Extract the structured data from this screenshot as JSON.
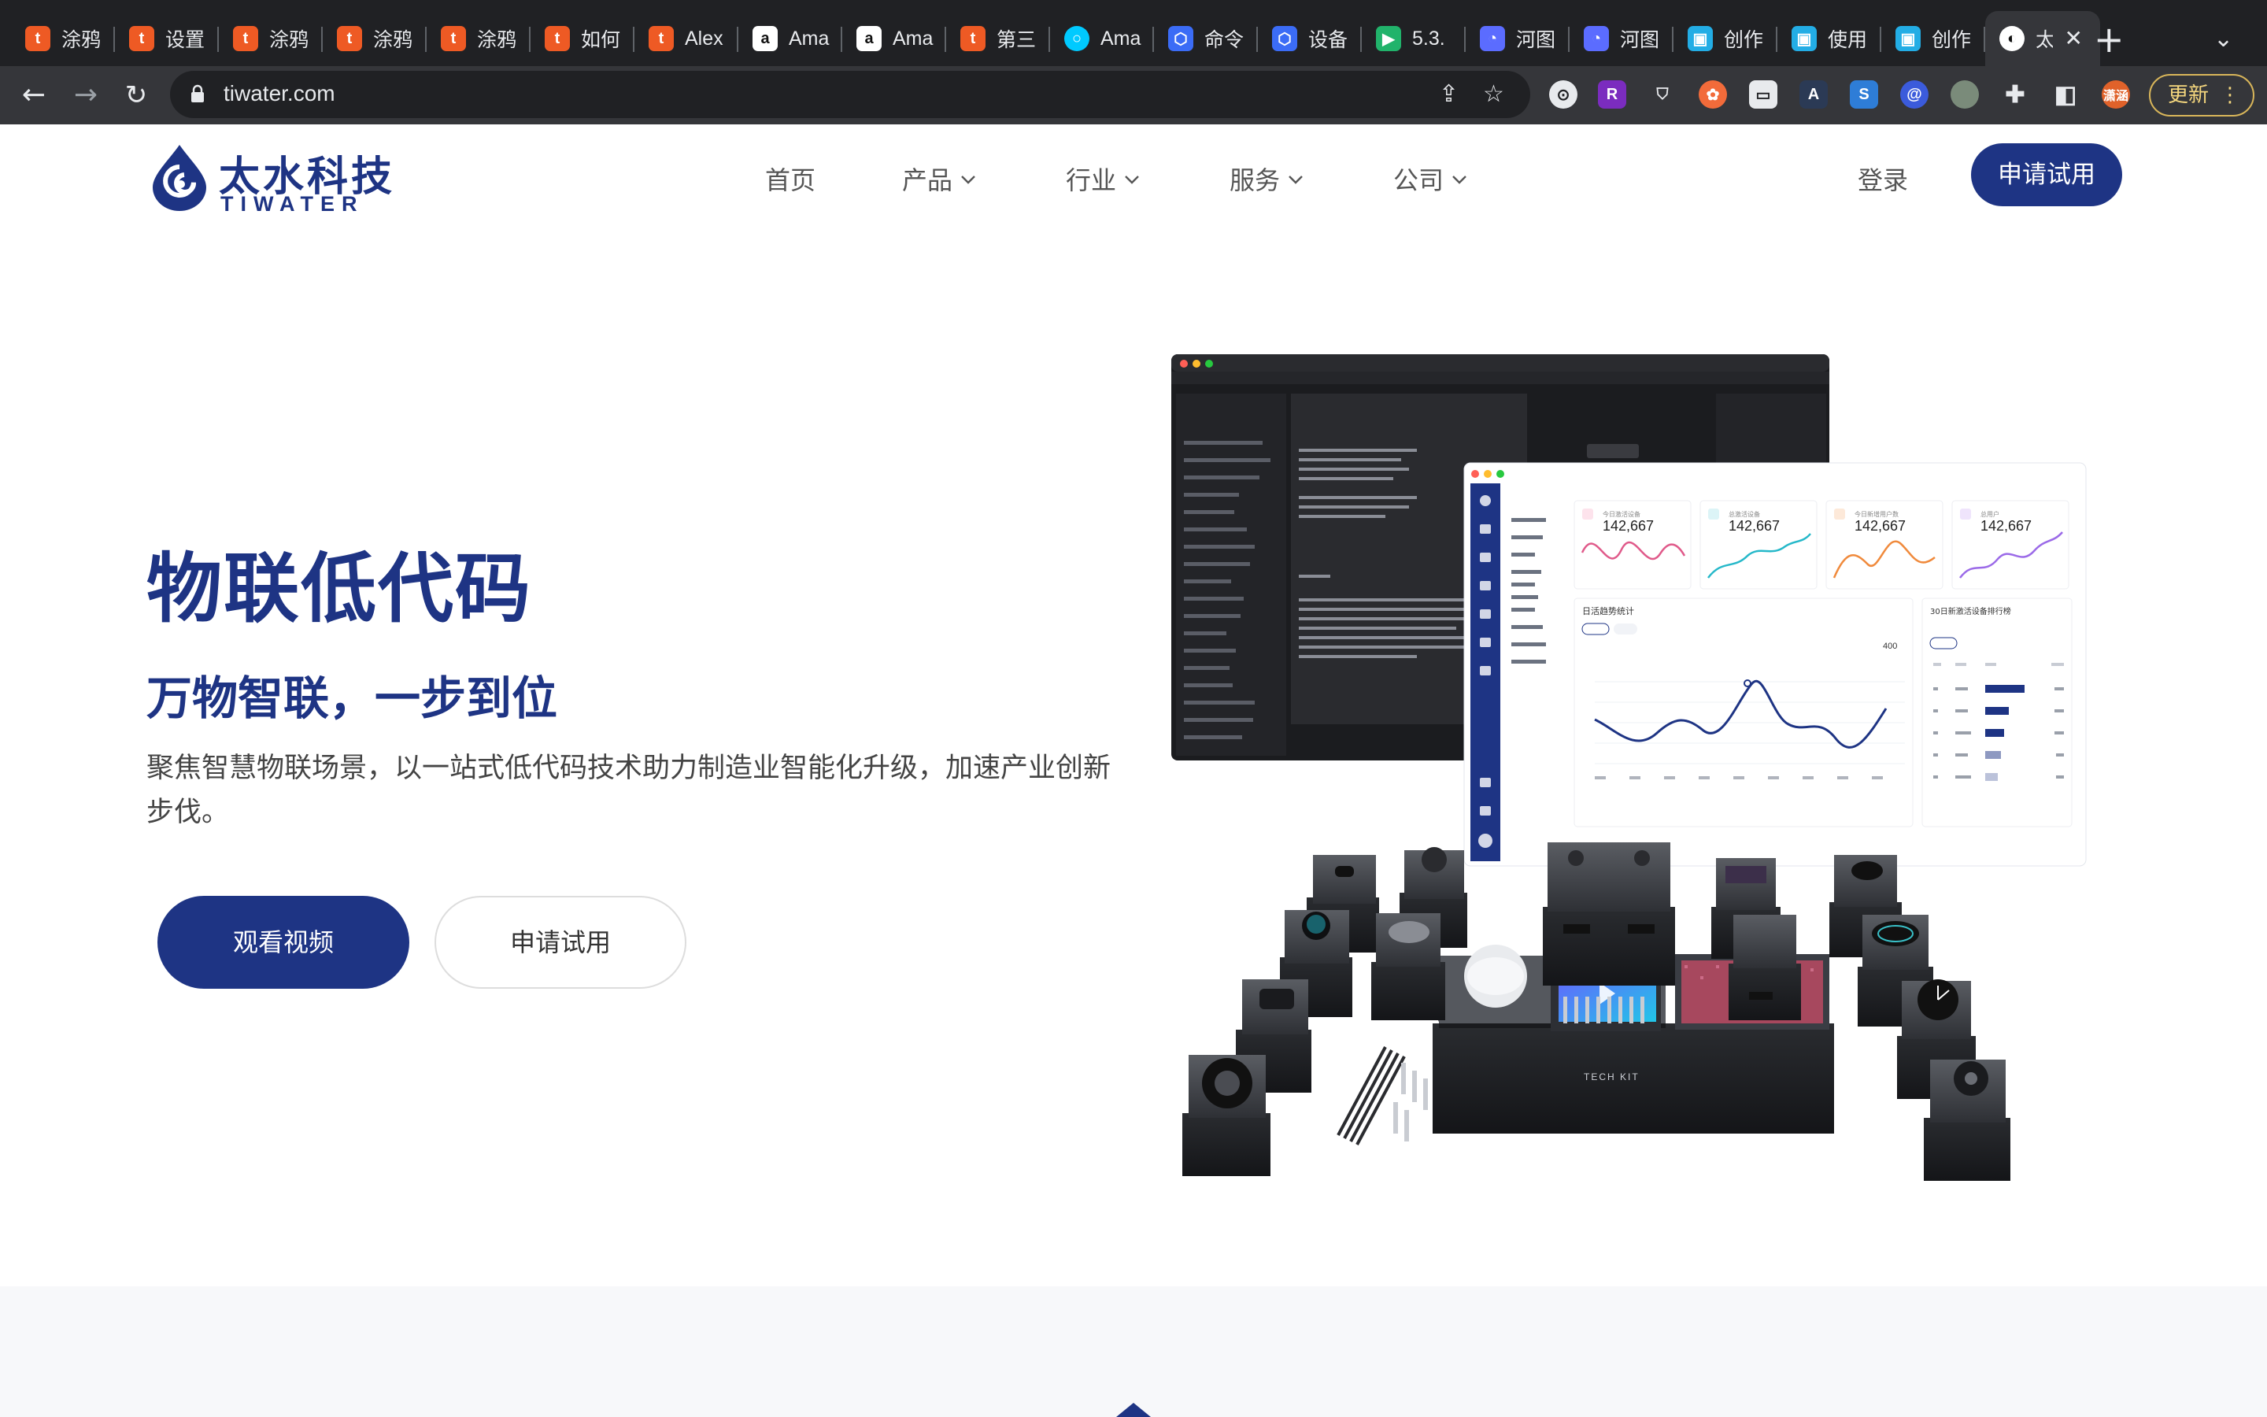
{
  "browser": {
    "tabs": [
      {
        "label": "涂鸦",
        "icon": "tuya-icon",
        "color": "#ee5a24"
      },
      {
        "label": "设置",
        "icon": "tuya-icon",
        "color": "#ee5a24"
      },
      {
        "label": "涂鸦",
        "icon": "tuya-icon",
        "color": "#ee5a24"
      },
      {
        "label": "涂鸦",
        "icon": "tuya-icon",
        "color": "#ee5a24"
      },
      {
        "label": "涂鸦",
        "icon": "tuya-icon",
        "color": "#ee5a24"
      },
      {
        "label": "如何",
        "icon": "tuya-icon",
        "color": "#ee5a24"
      },
      {
        "label": "Alex",
        "icon": "tuya-icon",
        "color": "#ee5a24"
      },
      {
        "label": "Ama",
        "icon": "amazon-icon",
        "color": "#ffffff"
      },
      {
        "label": "Ama",
        "icon": "amazon-icon",
        "color": "#ffffff"
      },
      {
        "label": "第三",
        "icon": "tuya-icon",
        "color": "#ee5a24"
      },
      {
        "label": "Ama",
        "icon": "alexa-icon",
        "color": "#00caff"
      },
      {
        "label": "命令",
        "icon": "hexagon-icon",
        "color": "#3b6cf6"
      },
      {
        "label": "设备",
        "icon": "hexagon-icon",
        "color": "#3b6cf6"
      },
      {
        "label": "5.3.",
        "icon": "play-icon",
        "color": "#21b36b"
      },
      {
        "label": "河图",
        "icon": "ghost-icon",
        "color": "#5b6cff"
      },
      {
        "label": "河图",
        "icon": "ghost-icon",
        "color": "#5b6cff"
      },
      {
        "label": "创作",
        "icon": "bilibili-icon",
        "color": "#23ade5"
      },
      {
        "label": "使用",
        "icon": "bilibili-icon",
        "color": "#23ade5"
      },
      {
        "label": "创作",
        "icon": "bilibili-icon",
        "color": "#23ade5"
      },
      {
        "label": "太",
        "icon": "tiwater-icon",
        "color": "#ffffff"
      }
    ],
    "url": "tiwater.com",
    "update_label": "更新",
    "profile_label": "潇涵"
  },
  "header": {
    "logo_cn": "太水科技",
    "logo_en": "TIWATER",
    "nav": [
      {
        "label": "首页",
        "dropdown": false
      },
      {
        "label": "产品",
        "dropdown": true
      },
      {
        "label": "行业",
        "dropdown": true
      },
      {
        "label": "服务",
        "dropdown": true
      },
      {
        "label": "公司",
        "dropdown": true
      }
    ],
    "login_label": "登录",
    "apply_label": "申请试用"
  },
  "hero": {
    "title": "物联低代码",
    "subtitle": "万物智联，一步到位",
    "description": "聚焦智慧物联场景，以一站式低代码技术助力制造业智能化升级，加速产业创新步伐。",
    "primary_button": "观看视频",
    "secondary_button": "申请试用"
  },
  "illustration": {
    "dashboard": {
      "stats": [
        {
          "label": "今日激活设备",
          "value": "142,667",
          "color": "#e05a8a"
        },
        {
          "label": "总激活设备",
          "value": "142,667",
          "color": "#25b8c9"
        },
        {
          "label": "今日新增用户数",
          "value": "142,667",
          "color": "#f08a3c"
        },
        {
          "label": "总用户",
          "value": "142,667",
          "color": "#9b6ae8"
        }
      ],
      "trend_title": "日活趋势统计",
      "trend_value": "400",
      "rank_title": "30日新激活设备排行榜"
    },
    "kit_label": "TECH KIT"
  },
  "colors": {
    "brand": "#1e3484",
    "chrome_bg": "#202124",
    "toolbar_bg": "#35363a"
  }
}
